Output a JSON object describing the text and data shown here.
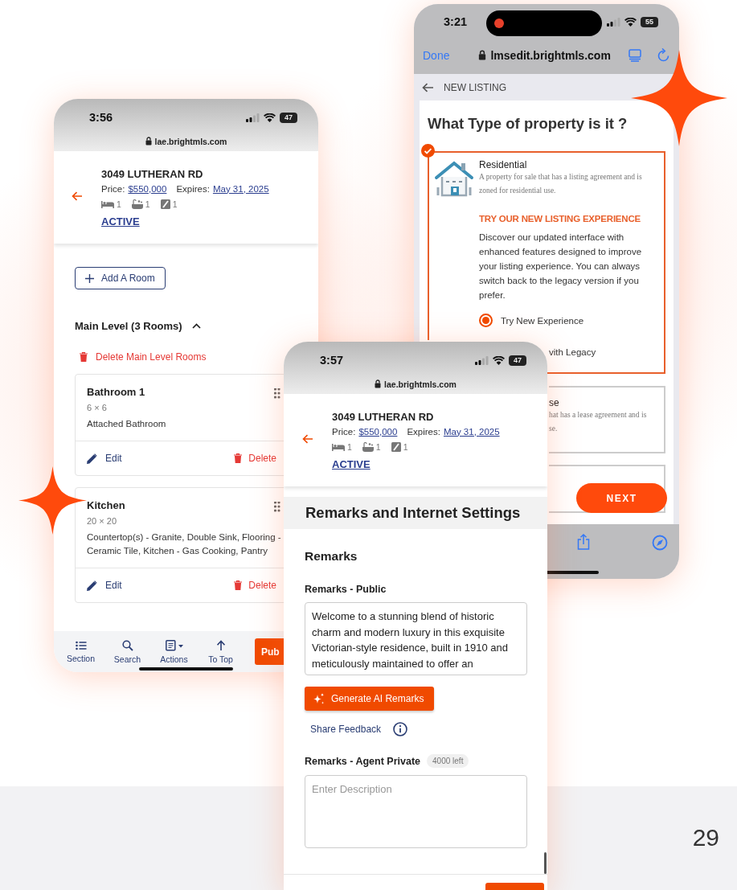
{
  "rooms_phone": {
    "status_bar": {
      "time": "3:56",
      "battery": "47"
    },
    "url": "lae.brightmls.com",
    "listing": {
      "address": "3049 LUTHERAN RD",
      "price_label": "Price:",
      "price": "$550,000",
      "expires_label": "Expires:",
      "expires": "May 31, 2025",
      "beds": "1",
      "baths": "1",
      "stairs": "1",
      "status": "ACTIVE"
    },
    "add_room_button": "Add A Room",
    "level_section": {
      "title": "Main Level (3 Rooms)",
      "expanded": true,
      "delete_link": "Delete Main Level Rooms"
    },
    "rooms": [
      {
        "name": "Bathroom 1",
        "size": "6 × 6",
        "features": "Attached Bathroom",
        "edit": "Edit",
        "delete": "Delete"
      },
      {
        "name": "Kitchen",
        "size": "20 × 20",
        "features": "Countertop(s) - Granite, Double Sink, Flooring - Ceramic Tile, Kitchen - Gas Cooking, Pantry",
        "edit": "Edit",
        "delete": "Delete"
      }
    ],
    "bottom_nav": [
      {
        "label": "Section"
      },
      {
        "label": "Search"
      },
      {
        "label": "Actions"
      },
      {
        "label": "To Top"
      }
    ],
    "publish_button": "Pub"
  },
  "listing_phone": {
    "status_bar": {
      "time": "3:21",
      "battery": "55"
    },
    "done": "Done",
    "url": "lmsedit.brightmls.com",
    "page_title": "NEW LISTING",
    "question": "What Type of property is it ?",
    "property_types": [
      {
        "name": "Residential",
        "description_lines": [
          "A property for sale that has a listing agreement and is",
          "zoned for residential use."
        ],
        "selected": true
      },
      {
        "name": "se",
        "description_lines": [
          "hat has a lease agreement and is",
          "se."
        ],
        "selected": false
      }
    ],
    "promo": {
      "title": "TRY OUR NEW LISTING EXPERIENCE",
      "text": "Discover our updated interface with enhanced features designed to improve your listing experience. You can always switch back to the legacy version if you prefer.",
      "new_experience_option": {
        "label": "Try New Experience",
        "selected": true
      },
      "legacy_option_fragment": "vith Legacy"
    },
    "next_button": "NEXT"
  },
  "remarks_phone": {
    "status_bar": {
      "time": "3:57",
      "battery": "47"
    },
    "url": "lae.brightmls.com",
    "listing": {
      "address": "3049 LUTHERAN RD",
      "price_label": "Price:",
      "price": "$550,000",
      "expires_label": "Expires:",
      "expires": "May 31, 2025",
      "beds": "1",
      "baths": "1",
      "stairs": "1",
      "status": "ACTIVE"
    },
    "section_title": "Remarks and Internet Settings",
    "subsection": "Remarks",
    "public_remarks": {
      "label": "Remarks - Public",
      "value": "Welcome to a stunning blend of historic charm and modern luxury in this exquisite Victorian-style residence, built in 1910 and meticulously maintained to offer an"
    },
    "generate_button": "Generate AI Remarks",
    "feedback_link": "Share Feedback",
    "agent_private": {
      "label": "Remarks - Agent Private",
      "counter": "4000 left",
      "placeholder": "Enter Description"
    }
  },
  "page_number": "29"
}
